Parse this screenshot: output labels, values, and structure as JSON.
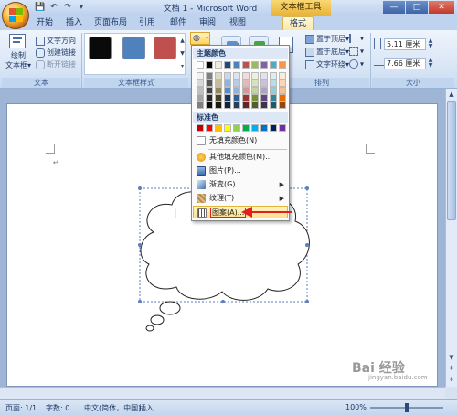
{
  "window": {
    "title": "文档 1 - Microsoft Word",
    "context_tab_group": "文本框工具",
    "controls": {
      "minimize": "—",
      "maximize": "□",
      "close": "✕"
    }
  },
  "qat": {
    "save": "💾",
    "undo": "↶",
    "redo": "↷",
    "more": "▾"
  },
  "tabs": [
    "开始",
    "插入",
    "页面布局",
    "引用",
    "邮件",
    "审阅",
    "视图",
    "格式"
  ],
  "active_tab": "格式",
  "ribbon": {
    "text_group": {
      "draw_textbox_line1": "绘制",
      "draw_textbox_line2": "文本框▾",
      "text_direction": "文字方向",
      "create_link": "创建链接",
      "break_link": "断开链接",
      "label": "文本"
    },
    "textbox_styles_group": {
      "label": "文本框样式",
      "swatches": [
        "#0a0a0a",
        "#4f81bd",
        "#c0504d"
      ]
    },
    "arrange_group": {
      "bring_front": "置于顶层▾",
      "send_back": "置于底层▾",
      "text_wrap": "文字环绕▾",
      "label": "排列"
    },
    "size_group": {
      "height": "5.11 厘米",
      "width": "7.66 厘米",
      "label": "大小"
    }
  },
  "menu": {
    "theme_colors_heading": "主题颜色",
    "standard_colors_heading": "标准色",
    "theme_top_row": [
      "#ffffff",
      "#000000",
      "#eeece1",
      "#1f497d",
      "#4f81bd",
      "#c0504d",
      "#9bbb59",
      "#8064a2",
      "#4bacc6",
      "#f79646"
    ],
    "theme_shades": [
      [
        "#f2f2f2",
        "#7f7f7f",
        "#ddd9c3",
        "#c6d9f0",
        "#dbe5f1",
        "#f2dcdb",
        "#ebf1dd",
        "#e5e0ec",
        "#dbeef3",
        "#fdeada"
      ],
      [
        "#d8d8d8",
        "#595959",
        "#c4bd97",
        "#8db3e2",
        "#b8cce4",
        "#e5b9b7",
        "#d7e3bc",
        "#ccc1d9",
        "#b7dde8",
        "#fbd5b5"
      ],
      [
        "#bfbfbf",
        "#3f3f3f",
        "#938953",
        "#548dd4",
        "#95b3d7",
        "#d99694",
        "#c3d69b",
        "#b2a2c7",
        "#92cddc",
        "#fac08f"
      ],
      [
        "#a5a5a5",
        "#262626",
        "#494429",
        "#17365d",
        "#366092",
        "#953734",
        "#76923c",
        "#5f497a",
        "#31859b",
        "#e36c09"
      ],
      [
        "#7f7f7f",
        "#0c0c0c",
        "#1d1b10",
        "#0f243e",
        "#244061",
        "#632423",
        "#4f6128",
        "#3f3151",
        "#205867",
        "#974806"
      ]
    ],
    "standard_colors": [
      "#c00000",
      "#ff0000",
      "#ffc000",
      "#ffff00",
      "#92d050",
      "#00b050",
      "#00b0f0",
      "#0070c0",
      "#002060",
      "#7030a0"
    ],
    "items": {
      "no_fill": "无填充颜色(N)",
      "more_colors": "其他填充颜色(M)...",
      "picture": "图片(P)...",
      "gradient": "渐变(G)",
      "texture": "纹理(T)",
      "pattern": "图案(A)..."
    },
    "submenu_arrow": "▶"
  },
  "document": {
    "cursor_mark": "↵",
    "textbox_caret": "|"
  },
  "statusbar": {
    "page": "页面: 1/1",
    "words": "字数: 0",
    "language": "中文(简体，中国)",
    "mode": "插入",
    "zoom": "100%"
  },
  "watermark": {
    "main": "Bai 经验",
    "sub": "jingyan.baidu.com"
  },
  "colors": {
    "annotation_red": "#e02020",
    "highlight": "#ffe08a"
  }
}
